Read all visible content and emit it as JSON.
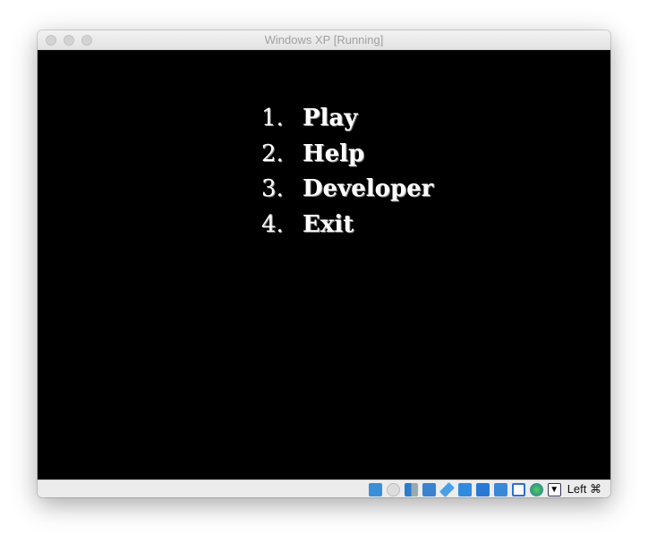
{
  "window": {
    "title": "Windows XP [Running]"
  },
  "menu": {
    "items": [
      {
        "number": "1.",
        "label": "Play"
      },
      {
        "number": "2.",
        "label": "Help"
      },
      {
        "number": "3.",
        "label": "Developer"
      },
      {
        "number": "4.",
        "label": "Exit"
      }
    ]
  },
  "status_bar": {
    "icons": [
      "hard-disk-icon",
      "optical-drive-icon",
      "audio-icon",
      "network-icon",
      "usb-icon",
      "shared-folders-icon",
      "display-icon",
      "video-capture-icon",
      "cpu-icon",
      "mouse-integration-icon",
      "keyboard-capture-icon"
    ],
    "host_key": "Left ⌘"
  }
}
